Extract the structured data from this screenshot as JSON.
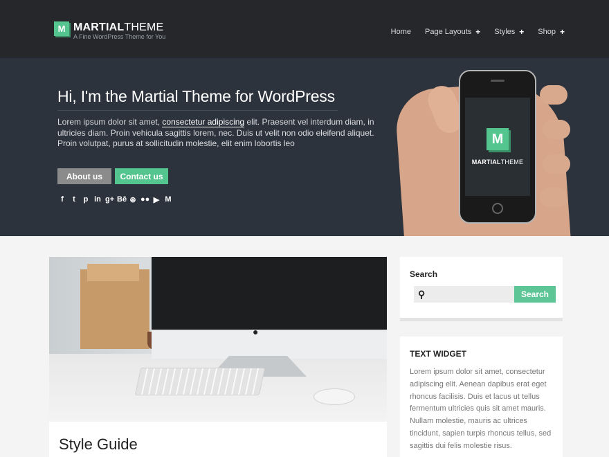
{
  "site": {
    "logo_letter": "M",
    "name_bold": "MARTIAL",
    "name_light": "THEME",
    "tagline": "A Fine WordPress Theme for You"
  },
  "nav": [
    {
      "label": "Home",
      "has_submenu": false
    },
    {
      "label": "Page Layouts",
      "has_submenu": true
    },
    {
      "label": "Styles",
      "has_submenu": true
    },
    {
      "label": "Shop",
      "has_submenu": true
    }
  ],
  "hero": {
    "title": "Hi, I'm the Martial Theme for WordPress",
    "text_before": "Lorem ipsum dolor sit amet, ",
    "link": "consectetur adipiscing",
    "text_after": " elit. Praesent vel interdum diam, in ultricies diam. Proin vehicula sagittis lorem, nec. Duis ut velit non odio eleifend aliquet. Proin volutpat, purus at sollicitudin molestie, elit enim lobortis leo",
    "button_about": "About us",
    "button_contact": "Contact us",
    "social_icons": [
      "facebook-icon",
      "twitter-icon",
      "pinterest-icon",
      "linkedin-icon",
      "googleplus-icon",
      "behance-icon",
      "dribbble-icon",
      "flickr-icon",
      "youtube-icon",
      "medium-icon"
    ],
    "social_glyphs": [
      "f",
      "t",
      "p",
      "in",
      "g+",
      "Bē",
      "⊛",
      "●●",
      "▶",
      "M"
    ],
    "phone_letter": "M",
    "phone_bold": "MARTIAL",
    "phone_light": "THEME"
  },
  "post": {
    "title": "Style Guide"
  },
  "sidebar": {
    "search_title": "Search",
    "search_placeholder": "",
    "search_button": "Search",
    "text_widget_title": "TEXT WIDGET",
    "text_widget_body": "Lorem ipsum dolor sit amet, consectetur adipiscing elit. Aenean dapibus erat eget rhoncus facilisis. Duis et lacus ut tellus fermentum ultricies quis sit amet mauris. Nullam molestie, mauris ac ultrices tincidunt, sapien turpis rhoncus tellus, sed sagittis dui felis molestie risus."
  },
  "colors": {
    "accent": "#55c58f",
    "header_bg": "#25272b",
    "hero_bg": "#2d333c"
  }
}
